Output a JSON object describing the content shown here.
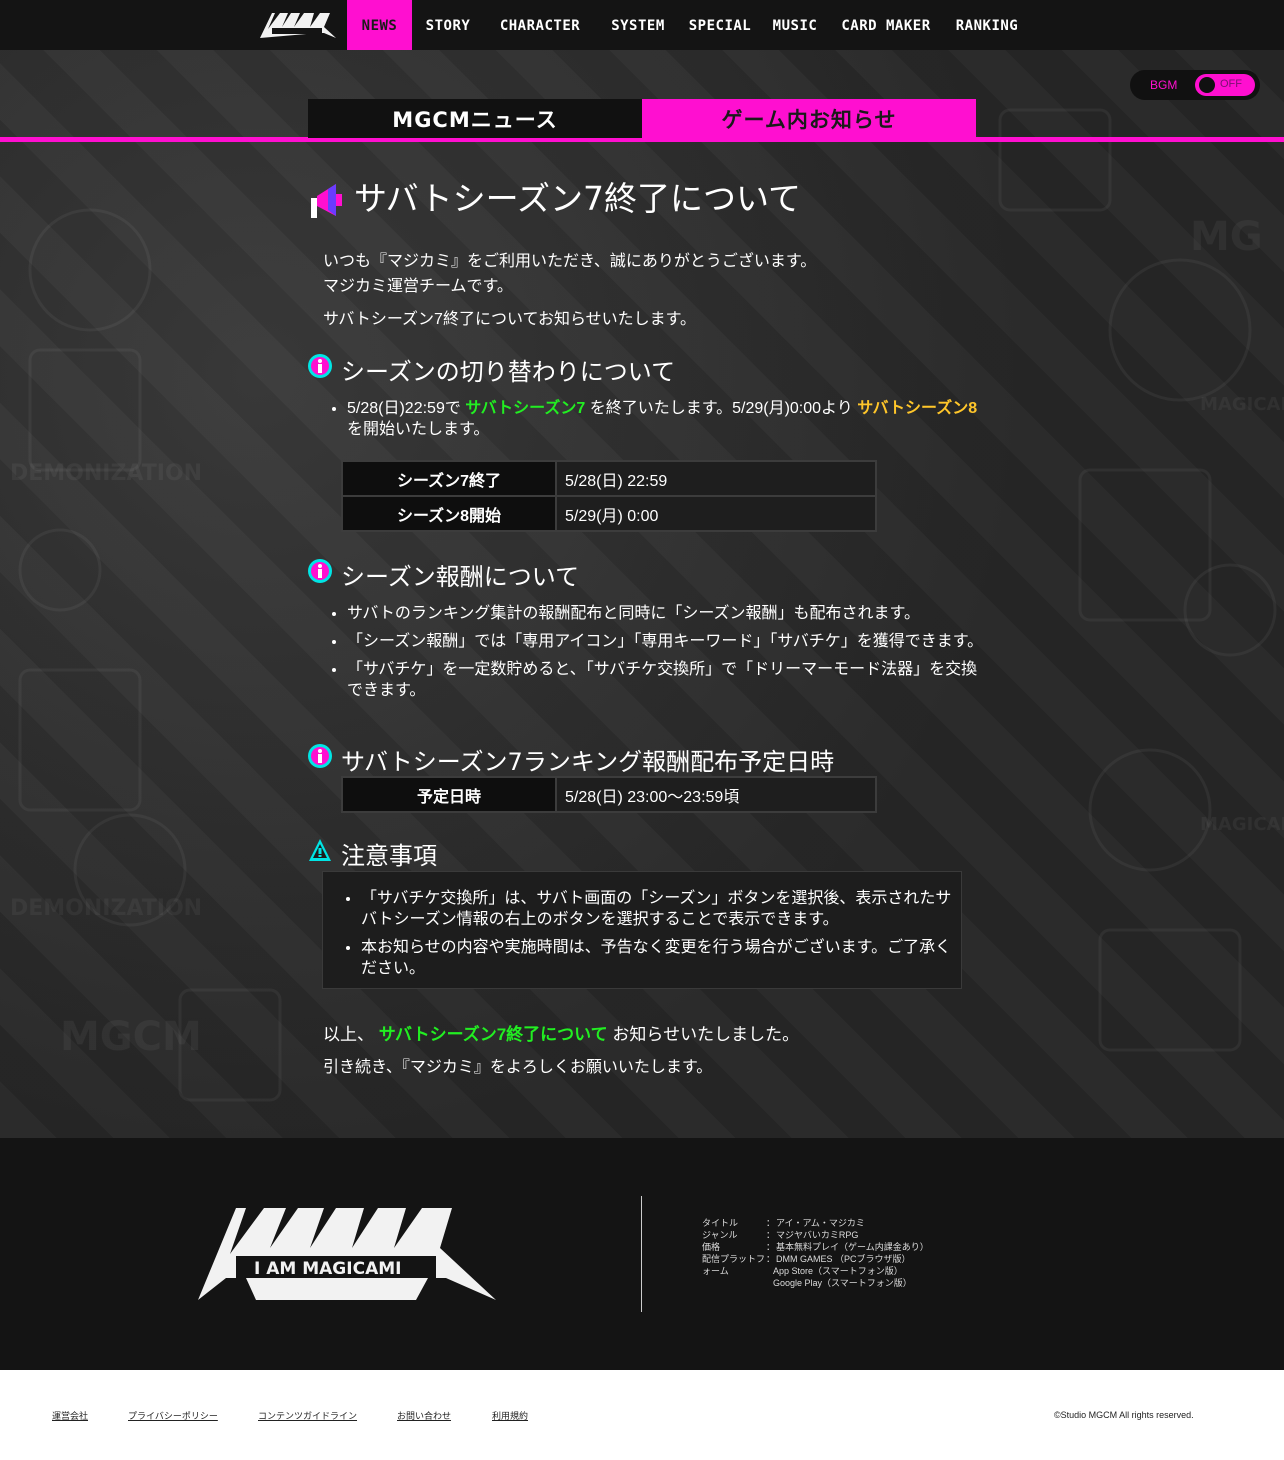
{
  "nav": {
    "logo_text": "I AM MAGICAMI",
    "items": [
      {
        "label": "NEWS",
        "active": true
      },
      {
        "label": "STORY",
        "active": false
      },
      {
        "label": "CHARACTER",
        "active": false
      },
      {
        "label": "SYSTEM",
        "active": false
      },
      {
        "label": "SPECIAL",
        "active": false
      },
      {
        "label": "MUSIC",
        "active": false
      },
      {
        "label": "CARD MAKER",
        "active": false
      },
      {
        "label": "RANKING",
        "active": false
      }
    ]
  },
  "bgm": {
    "label": "BGM",
    "state": "OFF"
  },
  "tabs": {
    "news": "MGCMニュース",
    "notice": "ゲーム内お知らせ",
    "active": "notice"
  },
  "article": {
    "title": "サバトシーズン7終了について",
    "intro_line1": "いつも『マジカミ』をご利用いただき、誠にありがとうございます。",
    "intro_line2": "マジカミ運営チームです。",
    "intro_line3": "サバトシーズン7終了についてお知らせいたします。",
    "sec1": {
      "heading": "シーズンの切り替わりについて",
      "bullet_a": "5/28(日)22:59で",
      "bullet_b": "サバトシーズン7",
      "bullet_c": "を終了いたします。5/29(月)0:00より",
      "bullet_d": "サバトシーズン8",
      "bullet_e": "を開始いたします。",
      "table": [
        {
          "label": "シーズン7終了",
          "value": "5/28(日) 22:59"
        },
        {
          "label": "シーズン8開始",
          "value": "5/29(月) 0:00"
        }
      ]
    },
    "sec2": {
      "heading": "シーズン報酬について",
      "bullets": [
        "サバトのランキング集計の報酬配布と同時に「シーズン報酬」も配布されます。",
        "「シーズン報酬」では「専用アイコン」「専用キーワード」「サバチケ」を獲得できます。",
        "「サバチケ」を一定数貯めると、「サバチケ交換所」で「ドリーマーモード法器」を交換できます。"
      ]
    },
    "sec3": {
      "heading": "サバトシーズン7ランキング報酬配布予定日時",
      "table": [
        {
          "label": "予定日時",
          "value": "5/28(日) 23:00～23:59頃"
        }
      ]
    },
    "sec4": {
      "heading": "注意事項",
      "bullets": [
        "「サバチケ交換所」は、サバト画面の「シーズン」ボタンを選択後、表示されたサバトシーズン情報の右上のボタンを選択することで表示できます。",
        "本お知らせの内容や実施時間は、予告なく変更を行う場合がございます。ご了承ください。"
      ]
    },
    "outro_a": "以上、",
    "outro_b": "サバトシーズン7終了について",
    "outro_c": "お知らせいたしました。",
    "outro_line2": "引き続き、『マジカミ』をよろしくお願いいたします。"
  },
  "footer": {
    "logo_text": "I AM MAGICAMI",
    "info": [
      {
        "key": "タイトル",
        "value": "アイ・アム・マジカミ"
      },
      {
        "key": "ジャンル",
        "value": "マジヤバいカミRPG"
      },
      {
        "key": "価格",
        "value": "基本無料プレイ（ゲーム内課金あり）"
      },
      {
        "key": "配信プラットフ",
        "value": "DMM GAMES （PCブラウザ版）"
      },
      {
        "key": "ォーム",
        "value": "App Store（スマートフォン版）"
      },
      {
        "key": "",
        "value": "Google Play（スマートフォン版）"
      }
    ],
    "links": [
      "運営会社",
      "プライバシーポリシー",
      "コンテンツガイドライン",
      "お問い合わせ",
      "利用規約"
    ],
    "copyright": "©Studio MGCM All rights reserved."
  },
  "colors": {
    "accent": "#ff0fd0",
    "green": "#22ee22",
    "yellow": "#ffc62a",
    "info_icon": "#00e5e5"
  }
}
